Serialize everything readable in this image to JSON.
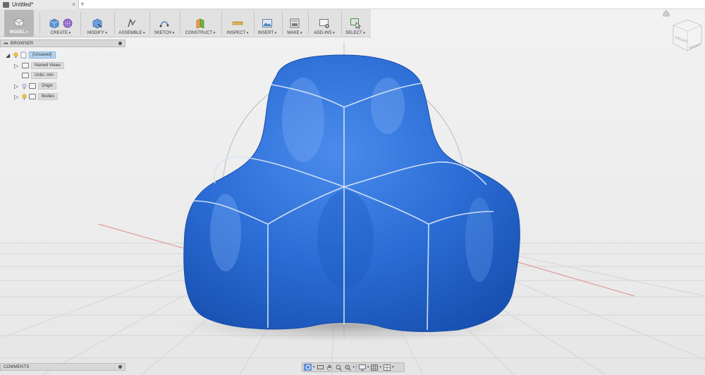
{
  "document": {
    "tab_title": "Untitled*",
    "close_glyph": "×",
    "new_tab_glyph": "+"
  },
  "toolbar": {
    "model_label": "MODEL",
    "groups": [
      {
        "label": "CREATE"
      },
      {
        "label": "MODIFY"
      },
      {
        "label": "ASSEMBLE"
      },
      {
        "label": "SKETCH"
      },
      {
        "label": "CONSTRUCT"
      },
      {
        "label": "INSPECT"
      },
      {
        "label": "INSERT"
      },
      {
        "label": "MAKE"
      },
      {
        "label": "ADD-INS"
      },
      {
        "label": "SELECT"
      }
    ]
  },
  "browser": {
    "title": "BROWSER",
    "collapse_glyph": "◂◂",
    "root": "(Unsaved)",
    "items": [
      {
        "label": "Named Views"
      },
      {
        "label": "Units: mm"
      },
      {
        "label": "Origin"
      },
      {
        "label": "Bodies"
      }
    ]
  },
  "viewcube": {
    "front": "FRONT",
    "right": "RIGHT"
  },
  "comments": {
    "title": "COMMENTS"
  },
  "colors": {
    "body_blue": "#2f74d6",
    "accent": "#5d8fd3",
    "toolbar_bg": "#e1e1e1",
    "grid_line": "#cfcfcf",
    "axis_red": "#e08a8a"
  }
}
